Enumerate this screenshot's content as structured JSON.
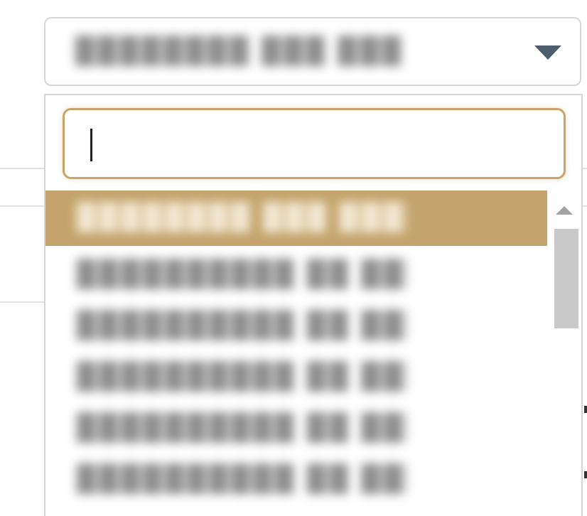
{
  "select": {
    "selected_value": "████████ ███ ████",
    "caret_icon": "caret-down-icon"
  },
  "search": {
    "value": "",
    "placeholder": ""
  },
  "options": [
    {
      "label": "████████ ███ ████",
      "highlighted": true
    },
    {
      "label": "██████████ ██ ████"
    },
    {
      "label": "██████████ ██ ████"
    },
    {
      "label": "██████████ ██ ████"
    },
    {
      "label": "██████████ ██ ████"
    },
    {
      "label": "██████████ ██ ████"
    }
  ],
  "colors": {
    "accent": "#c4a46c",
    "focus_border": "#c8a46a",
    "caret": "#4d5d6b"
  },
  "scrollbar": {
    "up_icon": "scroll-up-icon"
  }
}
